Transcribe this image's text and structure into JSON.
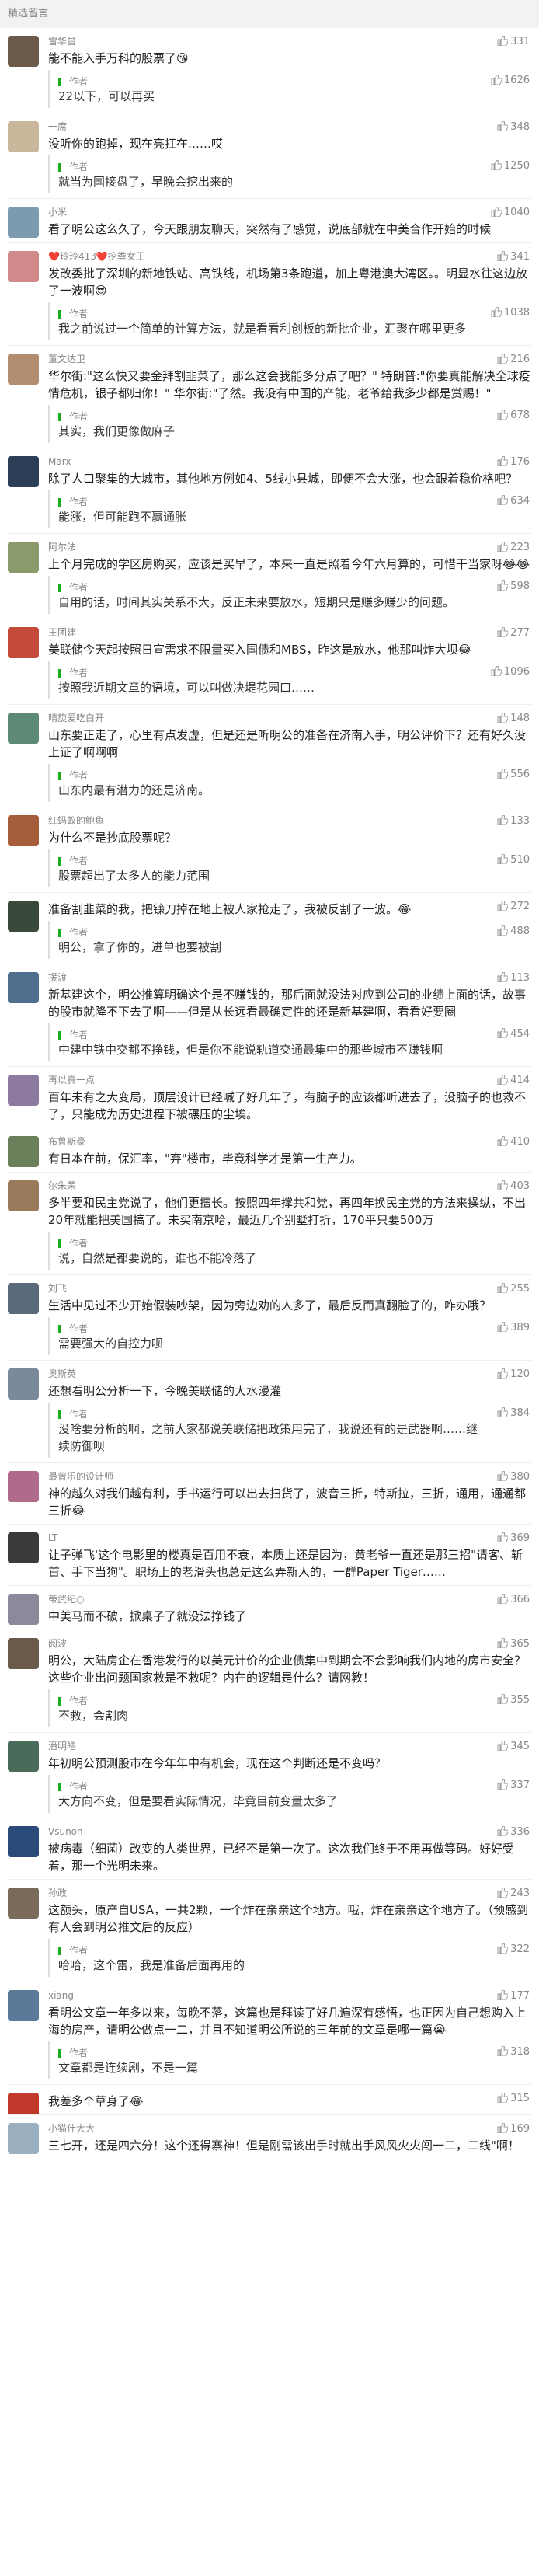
{
  "header": {
    "title": "精选留言"
  },
  "comments": [
    {
      "name": "雷华昌",
      "likes": "331",
      "text": "能不能入手万科的股票了😘",
      "reply": "22以下，可以再买",
      "reply_likes": "1626",
      "avatar_color": "#6b5a4a"
    },
    {
      "name": "一席",
      "likes": "348",
      "text": "没听你的跑掉，现在亮扛在……哎",
      "reply": "就当为国接盘了，早晚会挖出来的",
      "reply_likes": "1250",
      "avatar_color": "#c9b79c"
    },
    {
      "name": "小米",
      "likes": "1040",
      "text": "看了明公这么久了，今天跟朋友聊天，突然有了感觉，说底部就在中美合作开始的时候",
      "reply": "",
      "reply_likes": "",
      "avatar_color": "#7c9bb0"
    },
    {
      "name": "❤️玲玲413❤️挖粪女王",
      "likes": "341",
      "text": "发改委批了深圳的新地铁站、高铁线，机场第3条跑道，加上粤港澳大湾区。。明显水往这边放了一波啊😎",
      "reply": "我之前说过一个简单的计算方法，就是看看利创板的新批企业，汇聚在哪里更多",
      "reply_likes": "1038",
      "avatar_color": "#d08a8a"
    },
    {
      "name": "董文达卫",
      "likes": "216",
      "text": "华尔街:\"这么快又要金拜割韭菜了，那么这会我能多分点了吧？\" 特朗普:\"你要真能解决全球疫情危机，银子都归你！\" 华尔街:\"了然。我没有中国的产能，老爷给我多少都是赏赐！\"",
      "reply": "其实，我们更像做麻子",
      "reply_likes": "678",
      "avatar_color": "#b28d6f"
    },
    {
      "name": "Marx",
      "likes": "176",
      "text": "除了人口聚集的大城市，其他地方例如4、5线小县城，即便不会大涨，也会跟着稳价格吧？",
      "reply": "能涨，但可能跑不赢通胀",
      "reply_likes": "634",
      "avatar_color": "#2c3e55"
    },
    {
      "name": "阿尔法",
      "likes": "223",
      "text": "上个月完成的学区房购买，应该是买早了，本来一直是照着今年六月算的，可惜干当家呀😂😂",
      "reply": "自用的话，时间其实关系不大，反正未来要放水，短期只是赚多赚少的问题。",
      "reply_likes": "598",
      "avatar_color": "#8a9a6b"
    },
    {
      "name": "王团建",
      "likes": "277",
      "text": "美联储今天起按照日宣需求不限量买入国债和MBS，昨这是放水，他那叫炸大坝😂",
      "reply": "按照我近期文章的语境，可以叫做决堤花园口……",
      "reply_likes": "1096",
      "avatar_color": "#c44b3a"
    },
    {
      "name": "晴旋爱吃白开",
      "likes": "148",
      "text": "山东要正走了，心里有点发虚，但是还是听明公的准备在济南入手，明公评价下？还有好久没上证了啊啊啊",
      "reply": "山东内最有潜力的还是济南。",
      "reply_likes": "556",
      "avatar_color": "#5d8a74"
    },
    {
      "name": "红蚂蚁的鲍鱼",
      "likes": "133",
      "text": "为什么不是抄底股票呢？",
      "reply": "股票超出了太多人的能力范围",
      "reply_likes": "510",
      "avatar_color": "#a65d3a"
    },
    {
      "name": "",
      "likes": "272",
      "text": "准备割韭菜的我，把镰刀掉在地上被人家抢走了，我被反割了一波。😂",
      "reply": "明公，拿了你的，进单也要被割",
      "reply_likes": "488",
      "avatar_color": "#3a4a3a"
    },
    {
      "name": "援渡",
      "likes": "113",
      "text": "新基建这个，明公推算明确这个是不赚钱的，那后面就没法对应到公司的业绩上面的话，故事的股市就降不下去了啊——但是从长远看最确定性的还是新基建啊，看看好要圈",
      "reply": "中建中铁中交都不挣钱，但是你不能说轨道交通最集中的那些城市不赚钱啊",
      "reply_likes": "454",
      "avatar_color": "#4f6f8f"
    },
    {
      "name": "再以真一点",
      "likes": "414",
      "text": "百年未有之大变局，顶层设计已经喊了好几年了，有脑子的应该都听进去了，没脑子的也救不了，只能成为历史进程下被碾压的尘埃。",
      "reply": "",
      "reply_likes": "",
      "avatar_color": "#8c7b9e"
    },
    {
      "name": "布鲁斯豪",
      "likes": "410",
      "text": "有日本在前，保汇率，\"弃\"楼市，毕竟科学才是第一生产力。",
      "reply": "",
      "reply_likes": "",
      "avatar_color": "#6a7f5a"
    },
    {
      "name": "尔朱荣",
      "likes": "403",
      "text": "多半要和民主党说了，他们更擅长。按照四年撑共和党，再四年换民主党的方法来操纵，不出20年就能把美国搞了。未买南京哈，最近几个别墅打折，170平只要500万",
      "reply": "说，自然是都要说的，谁也不能冷落了",
      "reply_likes": "",
      "avatar_color": "#9a7a5a"
    },
    {
      "name": "刘飞",
      "likes": "255",
      "text": "生活中见过不少开始假装吵架，因为旁边劝的人多了，最后反而真翻脸了的，咋办哦？",
      "reply": "需要强大的自控力呗",
      "reply_likes": "389",
      "avatar_color": "#5a6a7a"
    },
    {
      "name": "奥斯英",
      "likes": "120",
      "text": "还想看明公分析一下，今晚美联储的大水漫灌",
      "reply": "没啥要分析的啊，之前大家都说美联储把政策用完了，我说还有的是武器啊……继续防御呗",
      "reply_likes": "384",
      "avatar_color": "#7a8a9a"
    },
    {
      "name": "最曾乐的设计师",
      "likes": "380",
      "text": "神的越久对我们越有利，手书运行可以出去扫货了，波音三折，特斯拉，三折，通用，通通都三折😂",
      "reply": "",
      "reply_likes": "",
      "avatar_color": "#b06a8a"
    },
    {
      "name": "LT",
      "likes": "369",
      "text": "让子弹飞'这个电影里的楼真是百用不衰，本质上还是因为，黄老爷一直还是那三招\"请客、斩首、手下当狗\"。职场上的老滑头也总是这么弄新人的，一群Paper Tiger……",
      "reply": "",
      "reply_likes": "",
      "avatar_color": "#3a3a3a"
    },
    {
      "name": "蒂武纪○",
      "likes": "366",
      "text": "中美马而不破，掀桌子了就没法挣钱了",
      "reply": "",
      "reply_likes": "",
      "avatar_color": "#8a8a9a"
    },
    {
      "name": "阅波",
      "likes": "365",
      "text": "明公，大陆房企在香港发行的以美元计价的企业债集中到期会不会影响我们内地的房市安全？这些企业出问题国家救是不救呢？内在的逻辑是什么？请网教！",
      "reply": "不救，会割肉",
      "reply_likes": "355",
      "avatar_color": "#6a5a4a"
    },
    {
      "name": "潘明皓",
      "likes": "345",
      "text": "年初明公预测股市在今年年中有机会，现在这个判断还是不变吗？",
      "reply": "大方向不变，但是要看实际情况，毕竟目前变量太多了",
      "reply_likes": "337",
      "avatar_color": "#4a6a5a"
    },
    {
      "name": "Vsunon",
      "likes": "336",
      "text": "被病毒（细菌）改变的人类世界，已经不是第一次了。这次我们终于不用再做等码。好好受着，那一个光明未来。",
      "reply": "",
      "reply_likes": "",
      "avatar_color": "#2a4a7a"
    },
    {
      "name": "孙政",
      "likes": "243",
      "text": "这额头，原产自USA，一共2颗，一个炸在亲亲这个地方。哦，炸在亲亲这个地方了。（预感到有人会到明公推文后的反应）",
      "reply": "哈哈，这个雷，我是准备后面再用的",
      "reply_likes": "322",
      "avatar_color": "#7a6a5a"
    },
    {
      "name": "xiang",
      "likes": "177",
      "text": "看明公文章一年多以来，每晚不落，这篇也是拜读了好几遍深有感悟，也正因为自己想购入上海的房产，请明公做点一二，并且不知道明公所说的三年前的文章是哪一篇😭",
      "reply": "文章都是连续剧，不是一篇",
      "reply_likes": "318",
      "avatar_color": "#5a7a9a"
    },
    {
      "name": "",
      "likes": "315",
      "text": "我差多个草身了😂",
      "reply": "",
      "reply_likes": "",
      "avatar_color": "#c0392b"
    },
    {
      "name": "小猫什大大",
      "likes": "169",
      "text": "三七开，还是四六分！这个还得寨神！但是刚需该出手时就出手风风火火闯一二，二线\"啊！",
      "reply": "",
      "reply_likes": "",
      "avatar_color": "#9ab0c0"
    }
  ]
}
